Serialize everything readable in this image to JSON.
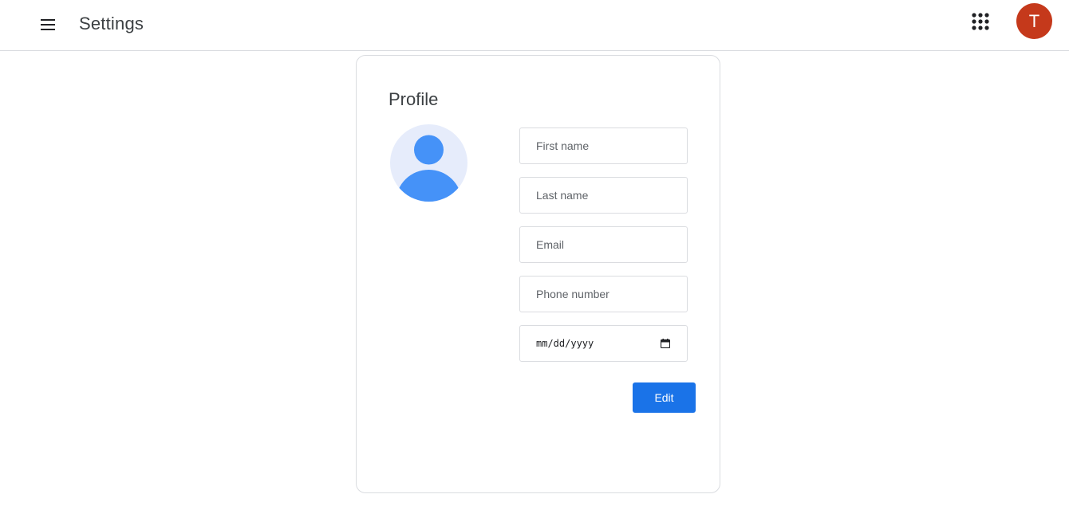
{
  "header": {
    "title": "Settings",
    "menu_icon": "menu-icon",
    "apps_icon": "apps-grid-icon",
    "account_initial": "T",
    "account_color": "#c5391b"
  },
  "profile": {
    "title": "Profile",
    "avatar_icon": "profile-placeholder-icon",
    "avatar_bg_color": "#e6ecfb",
    "avatar_fg_color": "#4592f8",
    "fields": {
      "first_name": {
        "placeholder": "First name",
        "value": ""
      },
      "last_name": {
        "placeholder": "Last name",
        "value": ""
      },
      "email": {
        "placeholder": "Email",
        "value": ""
      },
      "phone": {
        "placeholder": "Phone number",
        "value": ""
      },
      "birthdate": {
        "placeholder": "mm/dd/yyyy",
        "icon": "calendar-icon"
      }
    },
    "edit_label": "Edit",
    "edit_color": "#1a73e8"
  }
}
